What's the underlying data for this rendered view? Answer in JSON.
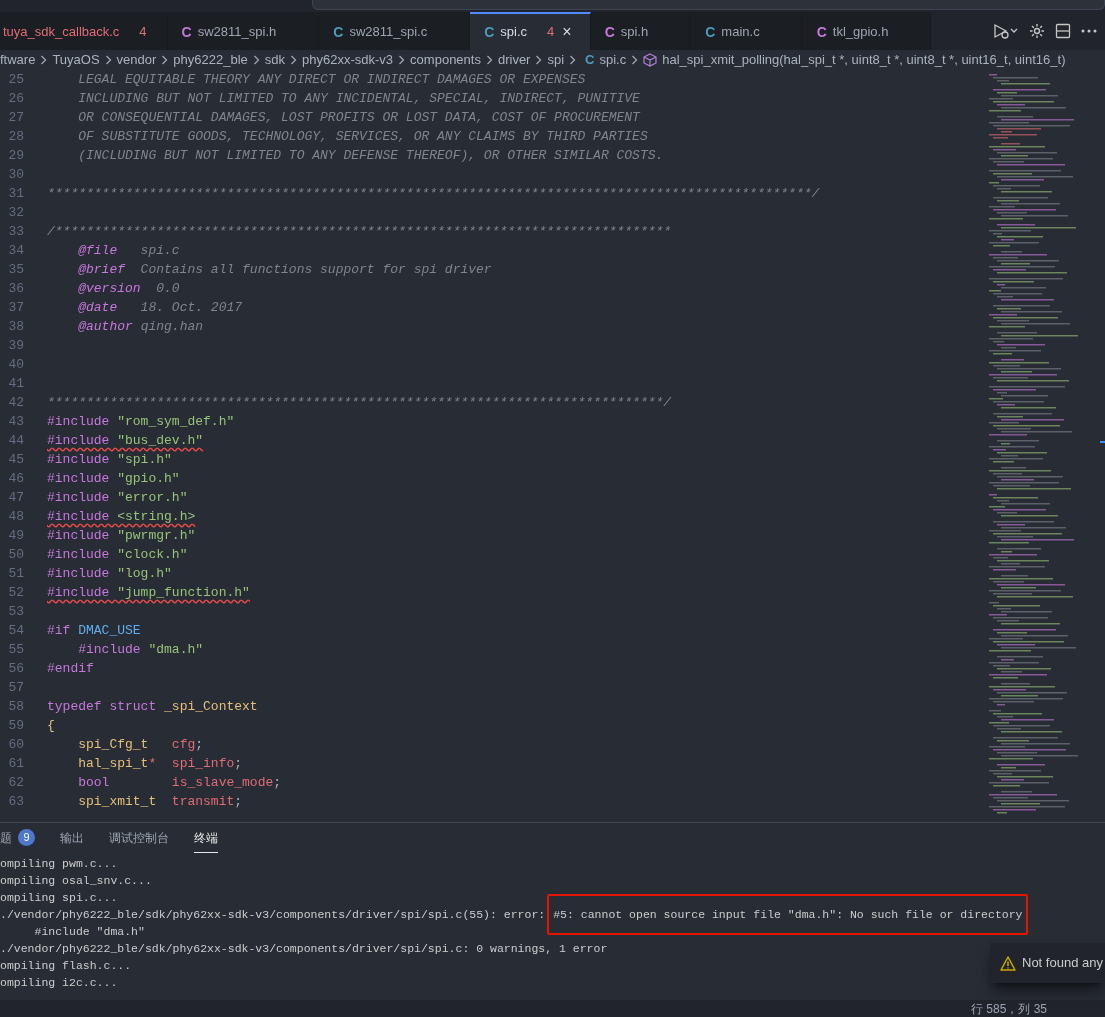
{
  "tabs": [
    {
      "label": "tuya_sdk_callback.c",
      "label_error": true,
      "problems": "4",
      "selected": false
    },
    {
      "label": "sw2811_spi.h",
      "icon": "C",
      "kind": "header",
      "label_error": false,
      "selected": false
    },
    {
      "label": "sw2811_spi.c",
      "icon": "C",
      "kind": "source",
      "label_error": false,
      "selected": false
    },
    {
      "label": "spi.c",
      "icon": "C",
      "kind": "source",
      "label_error": false,
      "problems": "4",
      "selected": true,
      "close": "×"
    },
    {
      "label": "spi.h",
      "icon": "C",
      "kind": "header",
      "label_error": false,
      "selected": false
    },
    {
      "label": "main.c",
      "icon": "C",
      "kind": "source",
      "label_error": false,
      "selected": false
    },
    {
      "label": "tkl_gpio.h",
      "icon": "C",
      "kind": "header",
      "label_error": false,
      "selected": false
    }
  ],
  "breadcrumb": {
    "folders": [
      "ftware",
      "TuyaOS",
      "vendor",
      "phy6222_ble",
      "sdk",
      "phy62xx-sdk-v3",
      "components",
      "driver",
      "spi"
    ],
    "file_icon": "C",
    "file": "spi.c",
    "symbol": "hal_spi_xmit_polling(hal_spi_t *, uint8_t *, uint8_t *, uint16_t, uint16_t)"
  },
  "editor": {
    "lines": [
      {
        "number": "25",
        "squiggle": false,
        "tokens": [
          {
            "kind": "comment",
            "text": "    LEGAL EQUITABLE THEORY ANY DIRECT OR INDIRECT DAMAGES OR EXPENSES"
          }
        ]
      },
      {
        "number": "26",
        "squiggle": false,
        "tokens": [
          {
            "kind": "comment",
            "text": "    INCLUDING BUT NOT LIMITED TO ANY INCIDENTAL, SPECIAL, INDIRECT, PUNITIVE"
          }
        ]
      },
      {
        "number": "27",
        "squiggle": false,
        "tokens": [
          {
            "kind": "comment",
            "text": "    OR CONSEQUENTIAL DAMAGES, LOST PROFITS OR LOST DATA, COST OF PROCUREMENT"
          }
        ]
      },
      {
        "number": "28",
        "squiggle": false,
        "tokens": [
          {
            "kind": "comment",
            "text": "    OF SUBSTITUTE GOODS, TECHNOLOGY, SERVICES, OR ANY CLAIMS BY THIRD PARTIES"
          }
        ]
      },
      {
        "number": "29",
        "squiggle": false,
        "tokens": [
          {
            "kind": "comment",
            "text": "    (INCLUDING BUT NOT LIMITED TO ANY DEFENSE THEREOF), OR OTHER SIMILAR COSTS."
          }
        ]
      },
      {
        "number": "30"
      },
      {
        "number": "31",
        "squiggle": false,
        "tokens": [
          {
            "kind": "comment",
            "text": "**************************************************************************************************/"
          }
        ]
      },
      {
        "number": "32"
      },
      {
        "number": "33",
        "squiggle": false,
        "tokens": [
          {
            "kind": "comment",
            "text": "/*******************************************************************************"
          }
        ]
      },
      {
        "number": "34",
        "squiggle": false,
        "tokens": [
          {
            "kind": "doctag",
            "text": "    @file"
          },
          {
            "kind": "comment",
            "text": "   spi.c"
          }
        ]
      },
      {
        "number": "35",
        "squiggle": false,
        "tokens": [
          {
            "kind": "doctag",
            "text": "    @brief"
          },
          {
            "kind": "comment",
            "text": "  Contains all functions support for spi driver"
          }
        ]
      },
      {
        "number": "36",
        "squiggle": false,
        "tokens": [
          {
            "kind": "doctag",
            "text": "    @version"
          },
          {
            "kind": "comment",
            "text": "  0.0"
          }
        ]
      },
      {
        "number": "37",
        "squiggle": false,
        "tokens": [
          {
            "kind": "doctag",
            "text": "    @date"
          },
          {
            "kind": "comment",
            "text": "   18. Oct. 2017"
          }
        ]
      },
      {
        "number": "38",
        "squiggle": false,
        "tokens": [
          {
            "kind": "doctag",
            "text": "    @author"
          },
          {
            "kind": "comment",
            "text": " qing.han"
          }
        ]
      },
      {
        "number": "39"
      },
      {
        "number": "40"
      },
      {
        "number": "41"
      },
      {
        "number": "42",
        "squiggle": false,
        "tokens": [
          {
            "kind": "comment",
            "text": "*******************************************************************************/"
          }
        ]
      },
      {
        "number": "43",
        "squiggle": false,
        "tokens": [
          {
            "kind": "preproc",
            "text": "#include "
          },
          {
            "kind": "string",
            "text": "\"rom_sym_def.h\""
          }
        ]
      },
      {
        "number": "44",
        "squiggle": true,
        "tokens": [
          {
            "kind": "preproc",
            "text": "#include "
          },
          {
            "kind": "string",
            "text": "\"bus_dev.h\""
          }
        ]
      },
      {
        "number": "45",
        "squiggle": false,
        "tokens": [
          {
            "kind": "preproc",
            "text": "#include "
          },
          {
            "kind": "string",
            "text": "\"spi.h\""
          }
        ]
      },
      {
        "number": "46",
        "squiggle": false,
        "tokens": [
          {
            "kind": "preproc",
            "text": "#include "
          },
          {
            "kind": "string",
            "text": "\"gpio.h\""
          }
        ]
      },
      {
        "number": "47",
        "squiggle": false,
        "tokens": [
          {
            "kind": "preproc",
            "text": "#include "
          },
          {
            "kind": "string",
            "text": "\"error.h\""
          }
        ]
      },
      {
        "number": "48",
        "squiggle": true,
        "tokens": [
          {
            "kind": "preproc",
            "text": "#include "
          },
          {
            "kind": "string",
            "text": "<string.h>"
          }
        ]
      },
      {
        "number": "49",
        "squiggle": false,
        "tokens": [
          {
            "kind": "preproc",
            "text": "#include "
          },
          {
            "kind": "string",
            "text": "\"pwrmgr.h\""
          }
        ]
      },
      {
        "number": "50",
        "squiggle": false,
        "tokens": [
          {
            "kind": "preproc",
            "text": "#include "
          },
          {
            "kind": "string",
            "text": "\"clock.h\""
          }
        ]
      },
      {
        "number": "51",
        "squiggle": false,
        "tokens": [
          {
            "kind": "preproc",
            "text": "#include "
          },
          {
            "kind": "string",
            "text": "\"log.h\""
          }
        ]
      },
      {
        "number": "52",
        "squiggle": true,
        "tokens": [
          {
            "kind": "preproc",
            "text": "#include "
          },
          {
            "kind": "string",
            "text": "\"jump_function.h\""
          }
        ]
      },
      {
        "number": "53"
      },
      {
        "number": "54",
        "squiggle": false,
        "tokens": [
          {
            "kind": "preproc",
            "text": "#if "
          },
          {
            "kind": "macro",
            "text": "DMAC_USE"
          }
        ]
      },
      {
        "number": "55",
        "squiggle": false,
        "tokens": [
          {
            "kind": "preproc",
            "text": "    #include "
          },
          {
            "kind": "string",
            "text": "\"dma.h\""
          }
        ]
      },
      {
        "number": "56",
        "squiggle": false,
        "tokens": [
          {
            "kind": "preproc",
            "text": "#endif"
          }
        ]
      },
      {
        "number": "57"
      },
      {
        "number": "58",
        "squiggle": false,
        "tokens": [
          {
            "kind": "keyword",
            "text": "typedef struct "
          },
          {
            "kind": "type",
            "text": "_spi_Context"
          }
        ]
      },
      {
        "number": "59",
        "squiggle": false,
        "tokens": [
          {
            "kind": "brace",
            "text": "{"
          }
        ]
      },
      {
        "number": "60",
        "squiggle": false,
        "tokens": [
          {
            "kind": "type",
            "text": "    spi_Cfg_t   "
          },
          {
            "kind": "field",
            "text": "cfg"
          },
          {
            "kind": "punct",
            "text": ";"
          }
        ]
      },
      {
        "number": "61",
        "squiggle": false,
        "tokens": [
          {
            "kind": "type",
            "text": "    hal_spi_t"
          },
          {
            "kind": "operator",
            "text": "*  "
          },
          {
            "kind": "field",
            "text": "spi_info"
          },
          {
            "kind": "punct",
            "text": ";"
          }
        ]
      },
      {
        "number": "62",
        "squiggle": false,
        "tokens": [
          {
            "kind": "keyword",
            "text": "    bool        "
          },
          {
            "kind": "field",
            "text": "is_slave_mode"
          },
          {
            "kind": "punct",
            "text": ";"
          }
        ]
      },
      {
        "number": "63",
        "squiggle": false,
        "tokens": [
          {
            "kind": "type",
            "text": "    spi_xmit_t  "
          },
          {
            "kind": "field",
            "text": "transmit"
          },
          {
            "kind": "punct",
            "text": ";"
          }
        ]
      }
    ]
  },
  "panel": {
    "tabs": [
      {
        "label": "题",
        "badge": "9",
        "selected": false
      },
      {
        "label": "输出",
        "selected": false
      },
      {
        "label": "调试控制台",
        "selected": false
      },
      {
        "label": "终端",
        "selected": true
      }
    ],
    "terminal": [
      [
        {
          "text": "ompiling pwm.c...",
          "highlighted": false
        }
      ],
      [
        {
          "text": "ompiling osal_snv.c...",
          "highlighted": false
        }
      ],
      [
        {
          "text": "ompiling spi.c...",
          "highlighted": false
        }
      ],
      [
        {
          "text": "./vendor/phy6222_ble/sdk/phy62xx-sdk-v3/components/driver/spi/spi.c(55): error:",
          "highlighted": false
        },
        {
          "text": "#5: cannot open source input file \"dma.h\": No such file or directory",
          "highlighted": true
        }
      ],
      [
        {
          "text": "     #include \"dma.h\"",
          "highlighted": false
        }
      ],
      [
        {
          "text": "./vendor/phy6222_ble/sdk/phy62xx-sdk-v3/components/driver/spi/spi.c: 0 warnings, 1 error",
          "highlighted": false
        }
      ],
      [
        {
          "text": "ompiling flash.c...",
          "highlighted": false
        }
      ],
      [
        {
          "text": "ompiling i2c.c...",
          "highlighted": false
        }
      ]
    ],
    "notification": "Not found any"
  },
  "status_bar": {
    "position": "行 585，列 35"
  }
}
